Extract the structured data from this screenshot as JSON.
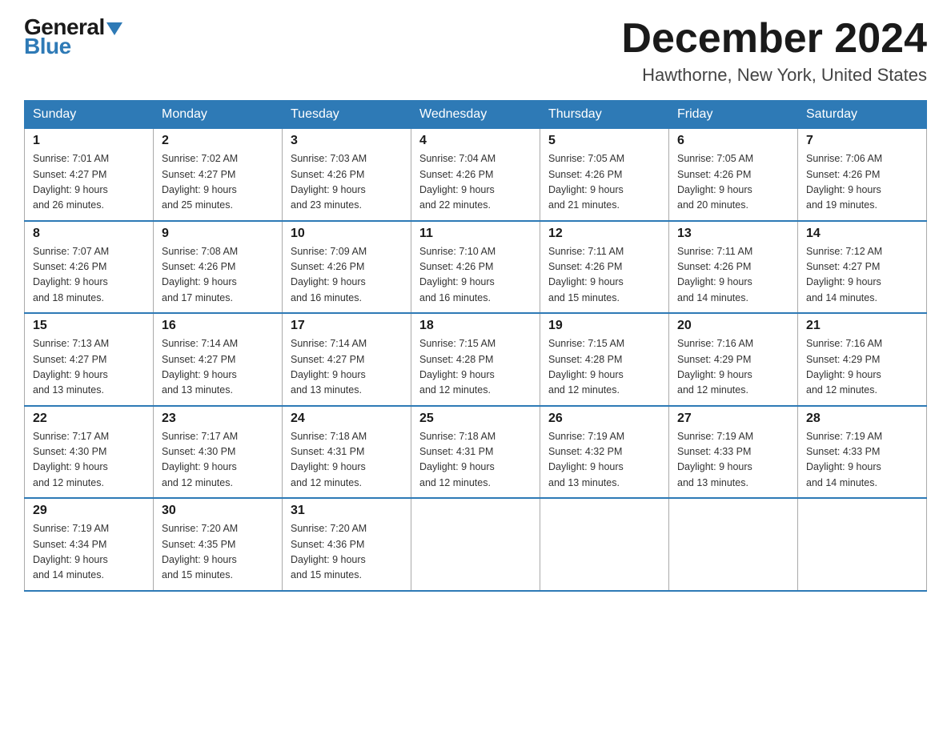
{
  "logo": {
    "line1": "General",
    "line2": "Blue"
  },
  "header": {
    "month": "December 2024",
    "location": "Hawthorne, New York, United States"
  },
  "weekdays": [
    "Sunday",
    "Monday",
    "Tuesday",
    "Wednesday",
    "Thursday",
    "Friday",
    "Saturday"
  ],
  "weeks": [
    [
      {
        "day": "1",
        "sunrise": "7:01 AM",
        "sunset": "4:27 PM",
        "daylight": "9 hours and 26 minutes."
      },
      {
        "day": "2",
        "sunrise": "7:02 AM",
        "sunset": "4:27 PM",
        "daylight": "9 hours and 25 minutes."
      },
      {
        "day": "3",
        "sunrise": "7:03 AM",
        "sunset": "4:26 PM",
        "daylight": "9 hours and 23 minutes."
      },
      {
        "day": "4",
        "sunrise": "7:04 AM",
        "sunset": "4:26 PM",
        "daylight": "9 hours and 22 minutes."
      },
      {
        "day": "5",
        "sunrise": "7:05 AM",
        "sunset": "4:26 PM",
        "daylight": "9 hours and 21 minutes."
      },
      {
        "day": "6",
        "sunrise": "7:05 AM",
        "sunset": "4:26 PM",
        "daylight": "9 hours and 20 minutes."
      },
      {
        "day": "7",
        "sunrise": "7:06 AM",
        "sunset": "4:26 PM",
        "daylight": "9 hours and 19 minutes."
      }
    ],
    [
      {
        "day": "8",
        "sunrise": "7:07 AM",
        "sunset": "4:26 PM",
        "daylight": "9 hours and 18 minutes."
      },
      {
        "day": "9",
        "sunrise": "7:08 AM",
        "sunset": "4:26 PM",
        "daylight": "9 hours and 17 minutes."
      },
      {
        "day": "10",
        "sunrise": "7:09 AM",
        "sunset": "4:26 PM",
        "daylight": "9 hours and 16 minutes."
      },
      {
        "day": "11",
        "sunrise": "7:10 AM",
        "sunset": "4:26 PM",
        "daylight": "9 hours and 16 minutes."
      },
      {
        "day": "12",
        "sunrise": "7:11 AM",
        "sunset": "4:26 PM",
        "daylight": "9 hours and 15 minutes."
      },
      {
        "day": "13",
        "sunrise": "7:11 AM",
        "sunset": "4:26 PM",
        "daylight": "9 hours and 14 minutes."
      },
      {
        "day": "14",
        "sunrise": "7:12 AM",
        "sunset": "4:27 PM",
        "daylight": "9 hours and 14 minutes."
      }
    ],
    [
      {
        "day": "15",
        "sunrise": "7:13 AM",
        "sunset": "4:27 PM",
        "daylight": "9 hours and 13 minutes."
      },
      {
        "day": "16",
        "sunrise": "7:14 AM",
        "sunset": "4:27 PM",
        "daylight": "9 hours and 13 minutes."
      },
      {
        "day": "17",
        "sunrise": "7:14 AM",
        "sunset": "4:27 PM",
        "daylight": "9 hours and 13 minutes."
      },
      {
        "day": "18",
        "sunrise": "7:15 AM",
        "sunset": "4:28 PM",
        "daylight": "9 hours and 12 minutes."
      },
      {
        "day": "19",
        "sunrise": "7:15 AM",
        "sunset": "4:28 PM",
        "daylight": "9 hours and 12 minutes."
      },
      {
        "day": "20",
        "sunrise": "7:16 AM",
        "sunset": "4:29 PM",
        "daylight": "9 hours and 12 minutes."
      },
      {
        "day": "21",
        "sunrise": "7:16 AM",
        "sunset": "4:29 PM",
        "daylight": "9 hours and 12 minutes."
      }
    ],
    [
      {
        "day": "22",
        "sunrise": "7:17 AM",
        "sunset": "4:30 PM",
        "daylight": "9 hours and 12 minutes."
      },
      {
        "day": "23",
        "sunrise": "7:17 AM",
        "sunset": "4:30 PM",
        "daylight": "9 hours and 12 minutes."
      },
      {
        "day": "24",
        "sunrise": "7:18 AM",
        "sunset": "4:31 PM",
        "daylight": "9 hours and 12 minutes."
      },
      {
        "day": "25",
        "sunrise": "7:18 AM",
        "sunset": "4:31 PM",
        "daylight": "9 hours and 12 minutes."
      },
      {
        "day": "26",
        "sunrise": "7:19 AM",
        "sunset": "4:32 PM",
        "daylight": "9 hours and 13 minutes."
      },
      {
        "day": "27",
        "sunrise": "7:19 AM",
        "sunset": "4:33 PM",
        "daylight": "9 hours and 13 minutes."
      },
      {
        "day": "28",
        "sunrise": "7:19 AM",
        "sunset": "4:33 PM",
        "daylight": "9 hours and 14 minutes."
      }
    ],
    [
      {
        "day": "29",
        "sunrise": "7:19 AM",
        "sunset": "4:34 PM",
        "daylight": "9 hours and 14 minutes."
      },
      {
        "day": "30",
        "sunrise": "7:20 AM",
        "sunset": "4:35 PM",
        "daylight": "9 hours and 15 minutes."
      },
      {
        "day": "31",
        "sunrise": "7:20 AM",
        "sunset": "4:36 PM",
        "daylight": "9 hours and 15 minutes."
      },
      null,
      null,
      null,
      null
    ]
  ],
  "labels": {
    "sunrise": "Sunrise:",
    "sunset": "Sunset:",
    "daylight": "Daylight:"
  }
}
